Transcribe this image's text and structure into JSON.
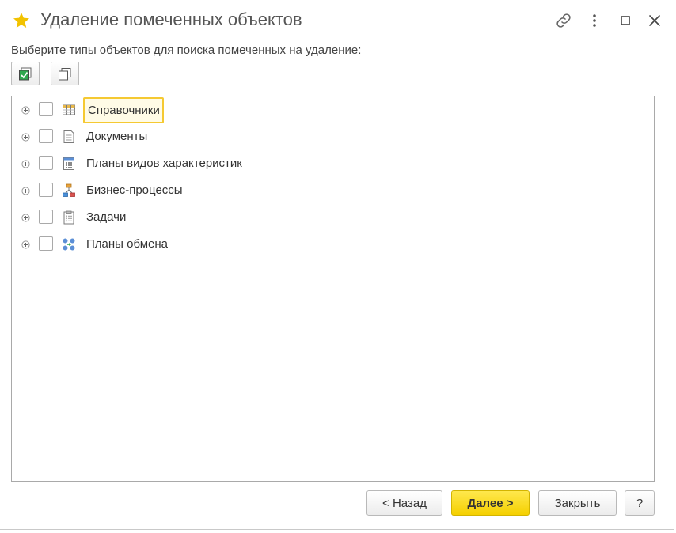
{
  "window": {
    "title": "Удаление помеченных объектов",
    "icons": {
      "favorite": "star-icon",
      "link": "link-icon",
      "more": "more-vertical-icon",
      "maximize": "maximize-icon",
      "close": "close-icon"
    }
  },
  "prompt": "Выберите типы объектов для поиска помеченных на удаление:",
  "toolbar": {
    "check_all_icon": "check-all-icon",
    "uncheck_all_icon": "uncheck-all-icon"
  },
  "tree": {
    "items": [
      {
        "label": "Справочники",
        "icon": "catalog-icon",
        "checked": false,
        "selected": true
      },
      {
        "label": "Документы",
        "icon": "document-icon",
        "checked": false,
        "selected": false
      },
      {
        "label": "Планы видов характеристик",
        "icon": "characteristic-plan-icon",
        "checked": false,
        "selected": false
      },
      {
        "label": "Бизнес-процессы",
        "icon": "business-process-icon",
        "checked": false,
        "selected": false
      },
      {
        "label": "Задачи",
        "icon": "task-icon",
        "checked": false,
        "selected": false
      },
      {
        "label": "Планы обмена",
        "icon": "exchange-plan-icon",
        "checked": false,
        "selected": false
      }
    ]
  },
  "footer": {
    "back_label": "< Назад",
    "next_label": "Далее >",
    "close_label": "Закрыть",
    "help_label": "?"
  },
  "colors": {
    "accent_yellow": "#f5d000",
    "selection_border": "#f5c932",
    "star": "#f2c200"
  }
}
